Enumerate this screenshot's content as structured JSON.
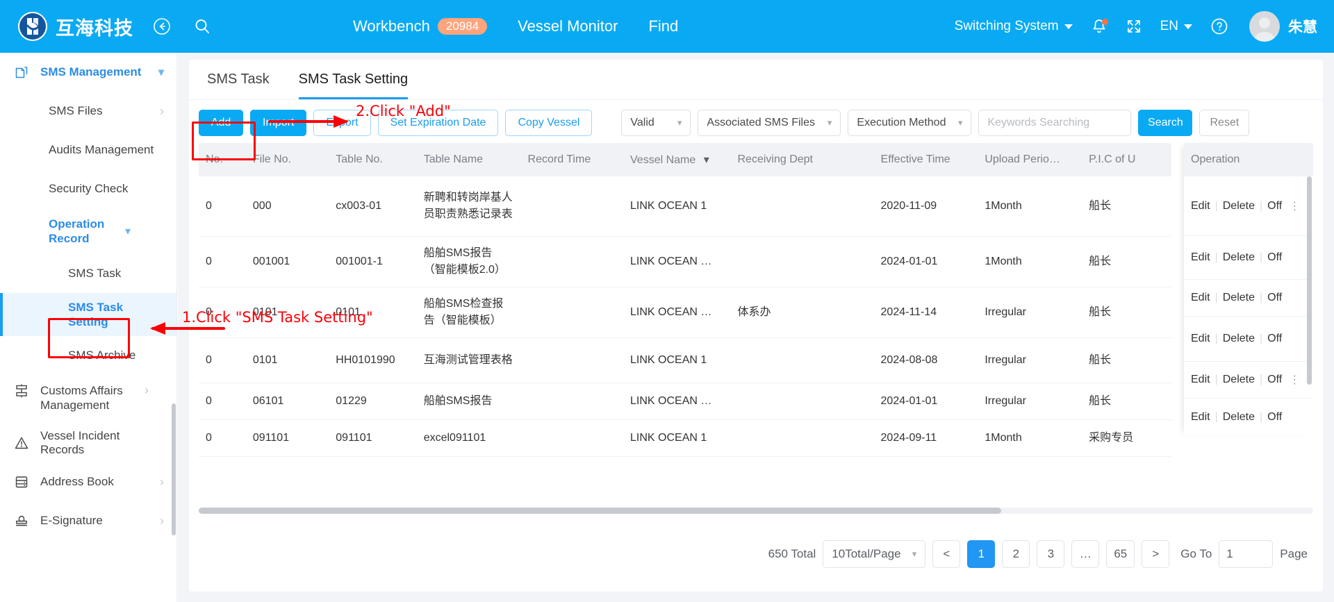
{
  "header": {
    "brand": "互海科技",
    "back_icon": "back-arrow-icon",
    "search_icon": "search-icon",
    "nav": [
      {
        "label": "Workbench",
        "badge": "20984"
      },
      {
        "label": "Vessel Monitor",
        "badge": ""
      },
      {
        "label": "Find",
        "badge": ""
      }
    ],
    "switch_system": "Switching System",
    "bell_icon": "bell-icon",
    "fullscreen_icon": "fullscreen-icon",
    "language": "EN",
    "help_icon": "help-icon",
    "username": "朱慧"
  },
  "sidebar": {
    "group": {
      "label": "SMS Management",
      "icon": "documents-icon"
    },
    "items": [
      {
        "label": "SMS Files",
        "chevron": "chevron-right-icon",
        "level": "item"
      },
      {
        "label": "Audits Management",
        "chevron": "",
        "level": "item"
      },
      {
        "label": "Security Check",
        "chevron": "",
        "level": "item"
      },
      {
        "label": "Operation Record",
        "chevron": "chevron-down-icon",
        "level": "item-expanded"
      },
      {
        "label": "SMS Task",
        "chevron": "",
        "level": "sub"
      },
      {
        "label": "SMS Task Setting",
        "chevron": "",
        "level": "sub-active"
      },
      {
        "label": "SMS Archive",
        "chevron": "",
        "level": "sub"
      }
    ],
    "modules": [
      {
        "label": "Customs Affairs Management",
        "icon": "customs-icon",
        "chevron": "chevron-right-icon"
      },
      {
        "label": "Vessel Incident Records",
        "icon": "warning-triangle-icon",
        "chevron": ""
      },
      {
        "label": "Address Book",
        "icon": "address-book-icon",
        "chevron": "chevron-right-icon"
      },
      {
        "label": "E-Signature",
        "icon": "stamp-icon",
        "chevron": "chevron-right-icon"
      }
    ]
  },
  "tabs": [
    {
      "label": "SMS Task",
      "active": false
    },
    {
      "label": "SMS Task Setting",
      "active": true
    }
  ],
  "toolbar": {
    "add": "Add",
    "import": "Import",
    "export": "Export",
    "set_expiration_date": "Set Expiration Date",
    "copy_vessel": "Copy Vessel",
    "filter_valid": "Valid",
    "filter_associated": "Associated SMS Files",
    "filter_execution": "Execution Method",
    "keywords_placeholder": "Keywords Searching",
    "keywords_value": "",
    "search": "Search",
    "reset": "Reset"
  },
  "table": {
    "columns": [
      "No.",
      "File No.",
      "Table No.",
      "Table Name",
      "Record Time",
      "Vessel Name",
      "Receiving Dept",
      "Effective Time",
      "Upload Perio…",
      "P.I.C of U"
    ],
    "sort_column": "Vessel Name",
    "operation_header": "Operation",
    "op_edit": "Edit",
    "op_delete": "Delete",
    "op_off": "Off",
    "rows": [
      {
        "no": "0",
        "file_no": "000",
        "table_no": "cx003-01",
        "table_name": "新聘和转岗岸基人员职责熟悉记录表",
        "record_time": "",
        "vessel_name": "LINK OCEAN 1",
        "receiving_dept": "",
        "effective_time": "2020-11-09",
        "upload_period": "1Month",
        "pic": "船长",
        "more": true
      },
      {
        "no": "0",
        "file_no": "001001",
        "table_no": "001001-1",
        "table_name": "船舶SMS报告（智能模板2.0）",
        "record_time": "",
        "vessel_name": "LINK OCEAN …",
        "receiving_dept": "",
        "effective_time": "2024-01-01",
        "upload_period": "1Month",
        "pic": "船长",
        "more": false
      },
      {
        "no": "0",
        "file_no": "0101",
        "table_no": "0101",
        "table_name": "船舶SMS检查报告（智能模板）",
        "record_time": "",
        "vessel_name": "LINK OCEAN …",
        "receiving_dept": "体系办",
        "effective_time": "2024-11-14",
        "upload_period": "Irregular",
        "pic": "船长",
        "more": false
      },
      {
        "no": "0",
        "file_no": "0101",
        "table_no": "HH0101990",
        "table_name": "互海测试管理表格",
        "record_time": "",
        "vessel_name": "LINK OCEAN 1",
        "receiving_dept": "",
        "effective_time": "2024-08-08",
        "upload_period": "Irregular",
        "pic": "船长",
        "more": false
      },
      {
        "no": "0",
        "file_no": "06101",
        "table_no": "01229",
        "table_name": "船舶SMS报告",
        "record_time": "",
        "vessel_name": "LINK OCEAN …",
        "receiving_dept": "",
        "effective_time": "2024-01-01",
        "upload_period": "Irregular",
        "pic": "船长",
        "more": true
      },
      {
        "no": "0",
        "file_no": "091101",
        "table_no": "091101",
        "table_name": "excel091101",
        "record_time": "",
        "vessel_name": "LINK OCEAN 1",
        "receiving_dept": "",
        "effective_time": "2024-09-11",
        "upload_period": "1Month",
        "pic": "采购专员",
        "more": false
      }
    ]
  },
  "pagination": {
    "total": "650 Total",
    "page_size": "10Total/Page",
    "prev": "<",
    "pages": [
      "1",
      "2",
      "3",
      "…",
      "65"
    ],
    "active_page": "1",
    "next": ">",
    "goto_label": "Go To",
    "goto_value": "1",
    "page_label": "Page"
  },
  "annotations": [
    {
      "text": "1.Click \"SMS Task Setting\"",
      "color": "#fb0007"
    },
    {
      "text": "2.Click \"Add\"",
      "color": "#fb0007"
    }
  ]
}
